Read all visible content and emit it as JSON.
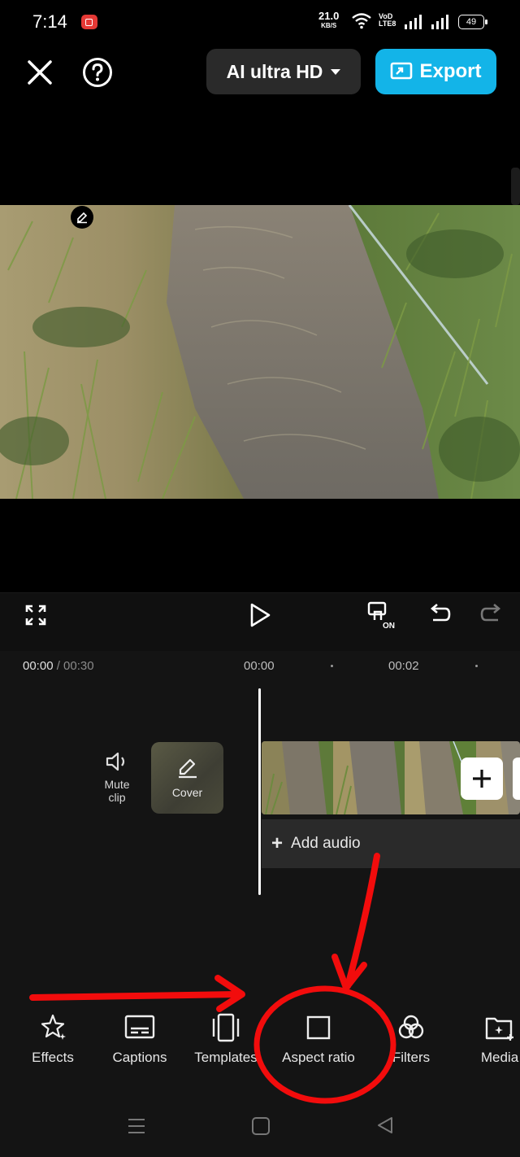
{
  "status_bar": {
    "time": "7:14",
    "net_speed": "21.0",
    "net_unit": "KB/S",
    "volte_top": "VoD",
    "volte_bottom": "LTE8",
    "battery": "49"
  },
  "top_bar": {
    "quality_label": "AI ultra HD",
    "export_label": "Export"
  },
  "controls": {
    "pip_state": "ON"
  },
  "timeline": {
    "current_time": "00:00",
    "total_time": "/ 00:30",
    "ticks": [
      "00:00",
      "00:02"
    ],
    "mute_label_line1": "Mute",
    "mute_label_line2": "clip",
    "cover_label": "Cover",
    "add_audio_label": "Add audio"
  },
  "toolbar": {
    "items": [
      {
        "label": "Effects",
        "icon": "sparkle-star-icon"
      },
      {
        "label": "Captions",
        "icon": "captions-icon"
      },
      {
        "label": "Templates",
        "icon": "templates-icon"
      },
      {
        "label": "Aspect ratio",
        "icon": "square-icon"
      },
      {
        "label": "Filters",
        "icon": "filters-icon"
      },
      {
        "label": "Media",
        "icon": "add-media-icon"
      }
    ]
  },
  "colors": {
    "accent": "#13b4e8",
    "annotation_red": "#f20c0c",
    "background": "#000000"
  }
}
